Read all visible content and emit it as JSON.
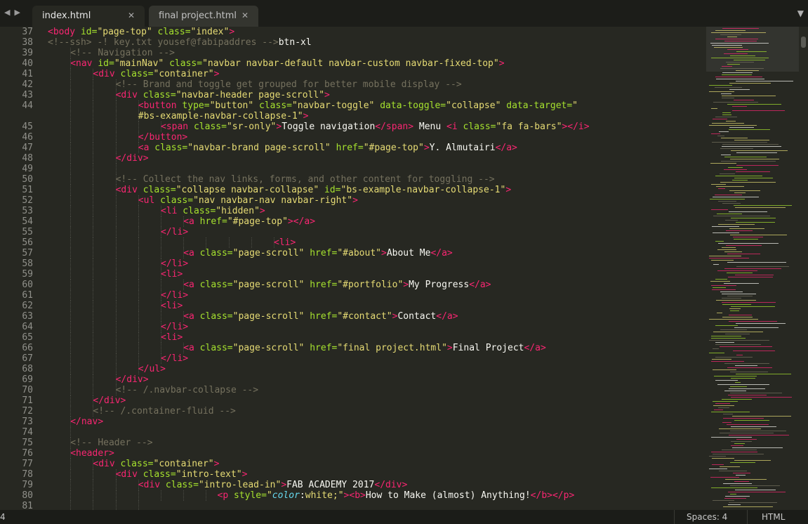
{
  "tabs": [
    {
      "label": "index.html",
      "active": true
    },
    {
      "label": "final project.html",
      "active": false
    }
  ],
  "lines": [
    {
      "n": "37",
      "indent": 0,
      "tokens": [
        [
          "tag",
          "<body"
        ],
        [
          "attr",
          " id="
        ],
        [
          "str",
          "\"page-top\""
        ],
        [
          "attr",
          " class="
        ],
        [
          "str",
          "\"index\""
        ],
        [
          "tag",
          ">"
        ]
      ]
    },
    {
      "n": "38",
      "indent": 0,
      "tokens": [
        [
          "cmt",
          "<!--ssh> -! key.txt yousef@fabipaddres -->"
        ],
        [
          "pl",
          "btn-xl"
        ]
      ]
    },
    {
      "n": "39",
      "indent": 1,
      "tokens": [
        [
          "cmt",
          "<!-- Navigation -->"
        ]
      ]
    },
    {
      "n": "40",
      "indent": 1,
      "tokens": [
        [
          "tag",
          "<nav"
        ],
        [
          "attr",
          " id="
        ],
        [
          "str",
          "\"mainNav\""
        ],
        [
          "attr",
          " class="
        ],
        [
          "str",
          "\"navbar navbar-default navbar-custom navbar-fixed-top\""
        ],
        [
          "tag",
          ">"
        ]
      ]
    },
    {
      "n": "41",
      "indent": 2,
      "tokens": [
        [
          "tag",
          "<div"
        ],
        [
          "attr",
          " class="
        ],
        [
          "str",
          "\"container\""
        ],
        [
          "tag",
          ">"
        ]
      ]
    },
    {
      "n": "42",
      "indent": 3,
      "tokens": [
        [
          "cmt",
          "<!-- Brand and toggle get grouped for better mobile display -->"
        ]
      ]
    },
    {
      "n": "43",
      "indent": 3,
      "tokens": [
        [
          "tag",
          "<div"
        ],
        [
          "attr",
          " class="
        ],
        [
          "str",
          "\"navbar-header page-scroll\""
        ],
        [
          "tag",
          ">"
        ]
      ]
    },
    {
      "n": "44",
      "indent": 4,
      "tokens": [
        [
          "tag",
          "<button"
        ],
        [
          "attr",
          " type="
        ],
        [
          "str",
          "\"button\""
        ],
        [
          "attr",
          " class="
        ],
        [
          "str",
          "\"navbar-toggle\""
        ],
        [
          "attr",
          " data-toggle="
        ],
        [
          "str",
          "\"collapse\""
        ],
        [
          "attr",
          " data-target="
        ],
        [
          "str",
          "\""
        ]
      ]
    },
    {
      "n": "",
      "indent": 4,
      "tokens": [
        [
          "str",
          "#bs-example-navbar-collapse-1\""
        ],
        [
          "tag",
          ">"
        ]
      ]
    },
    {
      "n": "45",
      "indent": 5,
      "tokens": [
        [
          "tag",
          "<span"
        ],
        [
          "attr",
          " class="
        ],
        [
          "str",
          "\"sr-only\""
        ],
        [
          "tag",
          ">"
        ],
        [
          "pl",
          "Toggle navigation"
        ],
        [
          "tag",
          "</span>"
        ],
        [
          "pl",
          " Menu "
        ],
        [
          "tag",
          "<i"
        ],
        [
          "attr",
          " class="
        ],
        [
          "str",
          "\"fa fa-bars\""
        ],
        [
          "tag",
          "></i>"
        ]
      ]
    },
    {
      "n": "46",
      "indent": 4,
      "tokens": [
        [
          "tag",
          "</button>"
        ]
      ]
    },
    {
      "n": "47",
      "indent": 4,
      "tokens": [
        [
          "tag",
          "<a"
        ],
        [
          "attr",
          " class="
        ],
        [
          "str",
          "\"navbar-brand page-scroll\""
        ],
        [
          "attr",
          " href="
        ],
        [
          "str",
          "\"#page-top\""
        ],
        [
          "tag",
          ">"
        ],
        [
          "pl",
          "Y. Almutairi"
        ],
        [
          "tag",
          "</a>"
        ]
      ]
    },
    {
      "n": "48",
      "indent": 3,
      "tokens": [
        [
          "tag",
          "</div>"
        ]
      ]
    },
    {
      "n": "49",
      "indent": 3,
      "tokens": []
    },
    {
      "n": "50",
      "indent": 3,
      "tokens": [
        [
          "cmt",
          "<!-- Collect the nav links, forms, and other content for toggling -->"
        ]
      ]
    },
    {
      "n": "51",
      "indent": 3,
      "tokens": [
        [
          "tag",
          "<div"
        ],
        [
          "attr",
          " class="
        ],
        [
          "str",
          "\"collapse navbar-collapse\""
        ],
        [
          "attr",
          " id="
        ],
        [
          "str",
          "\"bs-example-navbar-collapse-1\""
        ],
        [
          "tag",
          ">"
        ]
      ]
    },
    {
      "n": "52",
      "indent": 4,
      "tokens": [
        [
          "tag",
          "<ul"
        ],
        [
          "attr",
          " class="
        ],
        [
          "str",
          "\"nav navbar-nav navbar-right\""
        ],
        [
          "tag",
          ">"
        ]
      ]
    },
    {
      "n": "53",
      "indent": 5,
      "tokens": [
        [
          "tag",
          "<li"
        ],
        [
          "attr",
          " class="
        ],
        [
          "str",
          "\"hidden\""
        ],
        [
          "tag",
          ">"
        ]
      ]
    },
    {
      "n": "54",
      "indent": 6,
      "tokens": [
        [
          "tag",
          "<a"
        ],
        [
          "attr",
          " href="
        ],
        [
          "str",
          "\"#page-top\""
        ],
        [
          "tag",
          "></a>"
        ]
      ]
    },
    {
      "n": "55",
      "indent": 5,
      "tokens": [
        [
          "tag",
          "</li>"
        ]
      ]
    },
    {
      "n": "56",
      "indent": 10,
      "tokens": [
        [
          "tag",
          "<li>"
        ]
      ]
    },
    {
      "n": "57",
      "indent": 6,
      "tokens": [
        [
          "tag",
          "<a"
        ],
        [
          "attr",
          " class="
        ],
        [
          "str",
          "\"page-scroll\""
        ],
        [
          "attr",
          " href="
        ],
        [
          "str",
          "\"#about\""
        ],
        [
          "tag",
          ">"
        ],
        [
          "pl",
          "About Me"
        ],
        [
          "tag",
          "</a>"
        ]
      ]
    },
    {
      "n": "58",
      "indent": 5,
      "tokens": [
        [
          "tag",
          "</li>"
        ]
      ]
    },
    {
      "n": "59",
      "indent": 5,
      "tokens": [
        [
          "tag",
          "<li>"
        ]
      ]
    },
    {
      "n": "60",
      "indent": 6,
      "tokens": [
        [
          "tag",
          "<a"
        ],
        [
          "attr",
          " class="
        ],
        [
          "str",
          "\"page-scroll\""
        ],
        [
          "attr",
          " href="
        ],
        [
          "str",
          "\"#portfolio\""
        ],
        [
          "tag",
          ">"
        ],
        [
          "pl",
          "My Progress"
        ],
        [
          "tag",
          "</a>"
        ]
      ]
    },
    {
      "n": "61",
      "indent": 5,
      "tokens": [
        [
          "tag",
          "</li>"
        ]
      ]
    },
    {
      "n": "62",
      "indent": 5,
      "tokens": [
        [
          "tag",
          "<li>"
        ]
      ]
    },
    {
      "n": "63",
      "indent": 6,
      "tokens": [
        [
          "tag",
          "<a"
        ],
        [
          "attr",
          " class="
        ],
        [
          "str",
          "\"page-scroll\""
        ],
        [
          "attr",
          " href="
        ],
        [
          "str",
          "\"#contact\""
        ],
        [
          "tag",
          ">"
        ],
        [
          "pl",
          "Contact"
        ],
        [
          "tag",
          "</a>"
        ]
      ]
    },
    {
      "n": "64",
      "indent": 5,
      "tokens": [
        [
          "tag",
          "</li>"
        ]
      ]
    },
    {
      "n": "65",
      "indent": 5,
      "tokens": [
        [
          "tag",
          "<li>"
        ]
      ]
    },
    {
      "n": "66",
      "indent": 6,
      "tokens": [
        [
          "tag",
          "<a"
        ],
        [
          "attr",
          " class="
        ],
        [
          "str",
          "\"page-scroll\""
        ],
        [
          "attr",
          " href="
        ],
        [
          "str",
          "\"final project.html\""
        ],
        [
          "tag",
          ">"
        ],
        [
          "pl",
          "Final Project"
        ],
        [
          "tag",
          "</a>"
        ]
      ]
    },
    {
      "n": "67",
      "indent": 5,
      "tokens": [
        [
          "tag",
          "</li>"
        ]
      ]
    },
    {
      "n": "68",
      "indent": 4,
      "tokens": [
        [
          "tag",
          "</ul>"
        ]
      ]
    },
    {
      "n": "69",
      "indent": 3,
      "tokens": [
        [
          "tag",
          "</div>"
        ]
      ]
    },
    {
      "n": "70",
      "indent": 3,
      "tokens": [
        [
          "cmt",
          "<!-- /.navbar-collapse -->"
        ]
      ]
    },
    {
      "n": "71",
      "indent": 2,
      "tokens": [
        [
          "tag",
          "</div>"
        ]
      ]
    },
    {
      "n": "72",
      "indent": 2,
      "tokens": [
        [
          "cmt",
          "<!-- /.container-fluid -->"
        ]
      ]
    },
    {
      "n": "73",
      "indent": 1,
      "tokens": [
        [
          "tag",
          "</nav>"
        ]
      ]
    },
    {
      "n": "74",
      "indent": 1,
      "tokens": []
    },
    {
      "n": "75",
      "indent": 1,
      "tokens": [
        [
          "cmt",
          "<!-- Header -->"
        ]
      ]
    },
    {
      "n": "76",
      "indent": 1,
      "tokens": [
        [
          "tag",
          "<header>"
        ]
      ]
    },
    {
      "n": "77",
      "indent": 2,
      "tokens": [
        [
          "tag",
          "<div"
        ],
        [
          "attr",
          " class="
        ],
        [
          "str",
          "\"container\""
        ],
        [
          "tag",
          ">"
        ]
      ]
    },
    {
      "n": "78",
      "indent": 3,
      "tokens": [
        [
          "tag",
          "<div"
        ],
        [
          "attr",
          " class="
        ],
        [
          "str",
          "\"intro-text\""
        ],
        [
          "tag",
          ">"
        ]
      ]
    },
    {
      "n": "79",
      "indent": 4,
      "tokens": [
        [
          "tag",
          "<div"
        ],
        [
          "attr",
          " class="
        ],
        [
          "str",
          "\"intro-lead-in\""
        ],
        [
          "tag",
          ">"
        ],
        [
          "pl",
          "FAB ACADEMY 2017"
        ],
        [
          "tag",
          "</div>"
        ]
      ]
    },
    {
      "n": "80",
      "indent": 7.5,
      "tokens": [
        [
          "tag",
          "<p"
        ],
        [
          "attr",
          " style="
        ],
        [
          "str",
          "\""
        ],
        [
          "ital",
          "color"
        ],
        [
          "pl",
          ":"
        ],
        [
          "str",
          "white;\""
        ],
        [
          "tag",
          "><b>"
        ],
        [
          "pl",
          "How to Make (almost) Anything!"
        ],
        [
          "tag",
          "</b></p>"
        ]
      ]
    },
    {
      "n": "81",
      "indent": 4,
      "tokens": []
    }
  ],
  "status": {
    "left": "4",
    "indentation": "Spaces: 4",
    "syntax": "HTML"
  },
  "icons": {
    "back": "back-arrow-icon",
    "forward": "forward-arrow-icon",
    "close": "close-icon",
    "tab_menu": "chevron-down-icon"
  },
  "colors": {
    "background": "#272822",
    "tag": "#f92672",
    "attribute": "#a6e22e",
    "string": "#e6db74",
    "comment": "#75715e"
  }
}
